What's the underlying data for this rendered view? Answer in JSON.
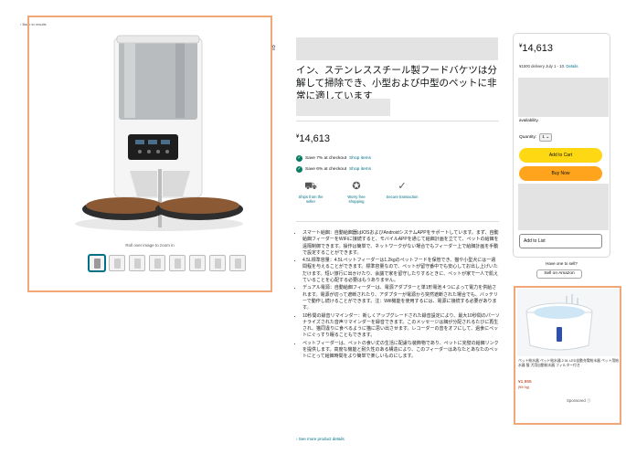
{
  "back_link": "‹ Back to results",
  "share_icon": "share-icon",
  "image": {
    "zoom_hint": "Roll over image to zoom in",
    "thumbnails": 8
  },
  "product": {
    "title": "イン、ステンレススチール製フードバケツは分解して掃除でき、小型および中型のペットに非常に適しています",
    "price_symbol": "¥",
    "price": "14,613",
    "promos": [
      {
        "text": "Save 7% at checkout",
        "link": "Shop items"
      },
      {
        "text": "Save 6% at checkout",
        "link": "Shop items"
      }
    ],
    "features": [
      {
        "icon": "truck-icon",
        "label": "Ships from the seller"
      },
      {
        "icon": "warranty-icon",
        "label": "Worry free shopping"
      },
      {
        "icon": "secure-icon",
        "label": "Secure transaction"
      }
    ],
    "bullets": [
      "スマート給餌：自動給餌器はIOSおよびAndroidシステムAPPをサポートしています。まず、自動給餌フィーダーをWiFiに接続すると、モバイルAPPを通じて給餌計画を立てて、ペットの給餌を遠隔制御できます。操作は簡単で、ネットワークがない場合でもフィーダー上で給餌計画を手動で設定することができます。",
      "4.5L標準容量：4.5Lペットフィーダーは1.2kgのペットフードを保管でき、猫や小型犬には一週間程を与えることができます。標準容量なので、ペットが留守番中でも安心してお出し上げいただけます。短い旅行に出かけたり、会議で家を留守したりするときに、ペットが家で一人で飢えていることを心配する必要はもうありません。",
      "デュアル電源：自動給餌フィーダーは、電源アダプターと単1形電池４つによって電力を供給されます。電源が切って遮断されたり、アダプターが電源から突然遮断された場合でも、バッテリーで動作し続けることができます。注：Wifi機能を使用するには、電源に接続する必要があります。",
      "10秒間の録音リマインダー：新しくアップグレードされた録音設定により、最大10秒間のパーソナライズされた音声リマインダーを録音できます。このメッセージは餌が分配されるたびに再生され、猫同違りに食べるように猫に思い出させます。レコーダーの音をオフにして、過食にペットにぐっすり眠ることもできます。",
      "ペットフィーダーは、ペットの食い丈の生活に配慮な装飾物であり、ペットに完璧の給餌リンクを提供します。高度な機能と耐久性のある構造により、このフィーダーはあなたとあなたのペットにとって給餌時間をより簡単で楽しいものにします。"
    ],
    "see_more": "See more product details"
  },
  "buybox": {
    "price": "14,613",
    "delivery": "¥1500 delivery July 1 - 10.",
    "details": "Details",
    "availability": "availability.",
    "quantity_label": "Quantity:",
    "quantity_value": "1",
    "add_to_cart": "Add to Cart",
    "buy_now": "Buy Now",
    "add_to_list": "Add to List",
    "sell_question": "Have one to sell?",
    "sell_button": "Sell on Amazon"
  },
  "ad": {
    "title": "ペット給水器 ペット給水器 2.5L LED自動充電給水器 ペット用給水器 猫 犬用自動給水器 フィルター付き",
    "price": "¥1,955",
    "sub": "(¥X/ kg)",
    "sponsored": "Sponsored"
  }
}
